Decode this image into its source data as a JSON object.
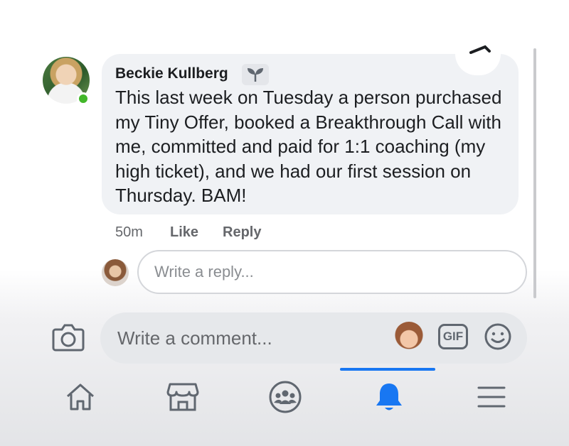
{
  "comment": {
    "author": "Beckie Kullberg",
    "badge_icon": "sprout-icon",
    "text": "This last week on Tuesday a person purchased my Tiny Offer, booked a Breakthrough Call with me, committed and paid for 1:1 coaching (my high ticket), and we had our first session on Thursday. BAM!",
    "time": "50m",
    "like_label": "Like",
    "reply_label": "Reply"
  },
  "reply_box": {
    "placeholder": "Write a reply..."
  },
  "composer": {
    "placeholder": "Write a comment...",
    "gif_label": "GIF"
  },
  "bottom_nav": {
    "items": [
      {
        "icon": "home-icon",
        "active": false
      },
      {
        "icon": "marketplace-icon",
        "active": false
      },
      {
        "icon": "groups-icon",
        "active": false
      },
      {
        "icon": "notifications-bell-icon",
        "active": true
      },
      {
        "icon": "menu-icon",
        "active": false
      }
    ]
  },
  "colors": {
    "accent": "#1877f2",
    "online": "#42b72a",
    "bubble": "#f0f2f5",
    "icon_gray": "#606770"
  }
}
